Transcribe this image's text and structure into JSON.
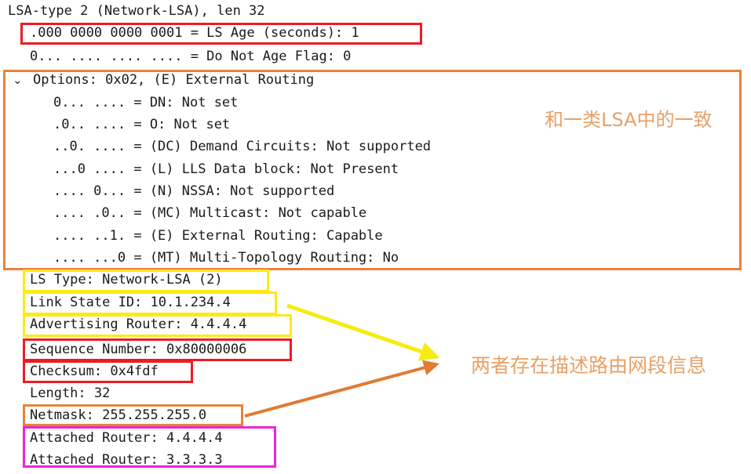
{
  "packet_tree": {
    "title_line": "LSA-type 2 (Network-LSA), len 32",
    "ls_age_line": ".000 0000 0000 0001 = LS Age (seconds): 1",
    "do_not_age_line": "0... .... .... .... = Do Not Age Flag: 0",
    "options_header": "Options: 0x02, (E) External Routing",
    "options_expand_icon": "chevron-down",
    "option_bits": [
      "0... .... = DN: Not set",
      ".0.. .... = O: Not set",
      "..0. .... = (DC) Demand Circuits: Not supported",
      "...0 .... = (L) LLS Data block: Not Present",
      ".... 0... = (N) NSSA: Not supported",
      ".... .0.. = (MC) Multicast: Not capable",
      ".... ..1. = (E) External Routing: Capable",
      ".... ...0 = (MT) Multi-Topology Routing: No"
    ],
    "header_fields": [
      "LS Type: Network-LSA (2)",
      "Link State ID: 10.1.234.4",
      "Advertising Router: 4.4.4.4",
      "Sequence Number: 0x80000006",
      "Checksum: 0x4fdf",
      "Length: 32",
      "Netmask: 255.255.255.0",
      "Attached Router: 4.4.4.4",
      "Attached Router: 3.3.3.3"
    ]
  },
  "annotations": {
    "options_note": "和一类LSA中的一致",
    "netmask_note": "两者存在描述路由网段信息"
  },
  "colors": {
    "red": "#ee1b24",
    "orange": "#e8823a",
    "yellow": "#ffe81a",
    "magenta": "#ee23d9",
    "note_text": "#e8a066",
    "arrow_yellow": "#f5ec12",
    "arrow_orange": "#e07b34",
    "text": "#1a1a1a"
  }
}
